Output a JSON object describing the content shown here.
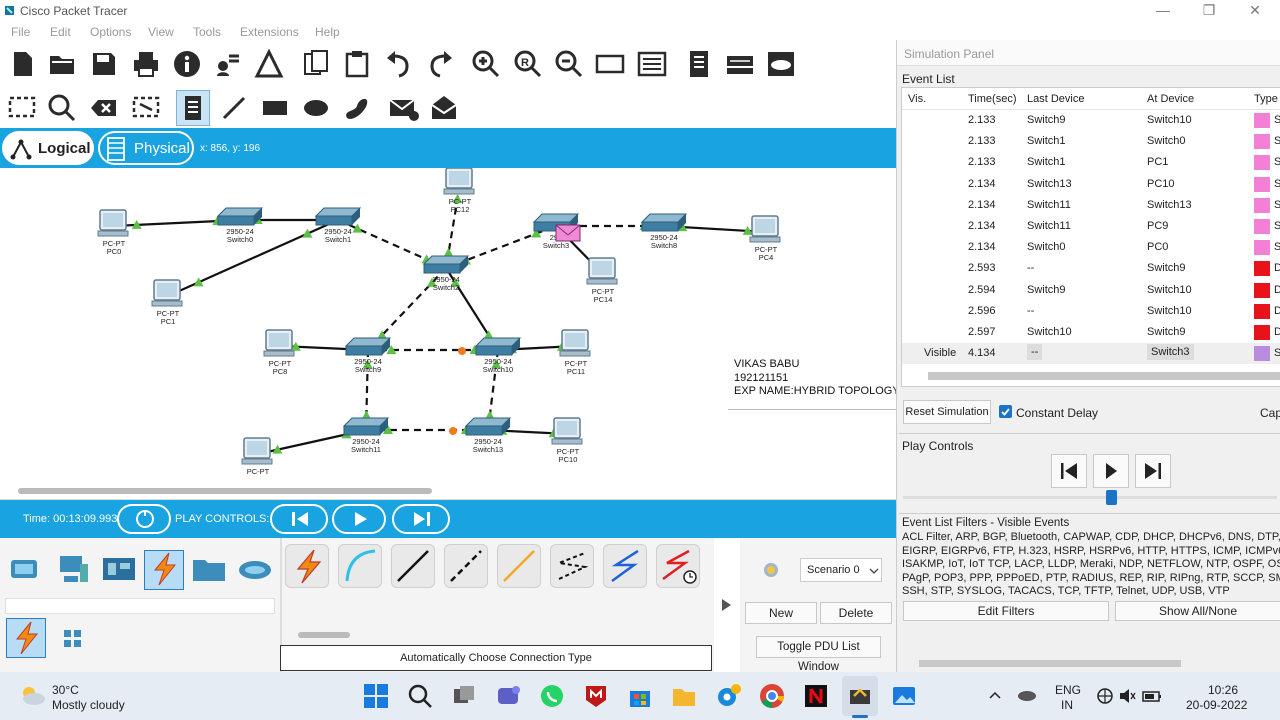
{
  "app": {
    "title": "Cisco Packet Tracer"
  },
  "window_controls": {
    "minimize": "—",
    "maximize": "❐",
    "close": "✕"
  },
  "menu": [
    "File",
    "Edit",
    "Options",
    "View",
    "Tools",
    "Extensions",
    "Help"
  ],
  "mode": {
    "logical": "Logical",
    "physical": "Physical",
    "coords": "x: 856, y: 196"
  },
  "devices": [
    {
      "model": "PC-PT",
      "name": "PC0"
    },
    {
      "model": "PC-PT",
      "name": "PC1"
    },
    {
      "model": "PC-PT",
      "name": "PC12"
    },
    {
      "model": "PC-PT",
      "name": "PC14"
    },
    {
      "model": "PC-PT",
      "name": "PC4"
    },
    {
      "model": "PC-PT",
      "name": "PC8"
    },
    {
      "model": "PC-PT",
      "name": "PC11"
    },
    {
      "model": "PC-PT",
      "name": "PC10"
    },
    {
      "model": "PC-PT",
      "name": ""
    },
    {
      "model": "2950-24",
      "name": "Switch0"
    },
    {
      "model": "2950-24",
      "name": "Switch1"
    },
    {
      "model": "2950-24",
      "name": "Switch2"
    },
    {
      "model": "295",
      "name": "Switch3"
    },
    {
      "model": "2950-24",
      "name": "Switch8"
    },
    {
      "model": "2950-24",
      "name": "Switch9"
    },
    {
      "model": "2950-24",
      "name": "Switch10"
    },
    {
      "model": "2950-24",
      "name": "Switch11"
    },
    {
      "model": "2950-24",
      "name": "Switch13"
    }
  ],
  "note": {
    "line1": "VIKAS BABU",
    "line2": "192121151",
    "line3": "EXP NAME:HYBRID TOPOLOGY"
  },
  "timebar": {
    "time": "Time: 00:13:09.993",
    "play_controls": "PLAY CONTROLS:"
  },
  "bottom": {
    "scenario": "Scenario 0",
    "new": "New",
    "delete": "Delete",
    "toggle": "Toggle PDU List Window",
    "auto_conn": "Automatically Choose Connection Type",
    "info": "i"
  },
  "sim": {
    "title": "Simulation Panel",
    "event_list": "Event List",
    "headers": [
      "Vis.",
      "Time(sec)",
      "Last Device",
      "At Device",
      "Type"
    ],
    "events": [
      {
        "vis": "",
        "time": "2.133",
        "last": "Switch9",
        "at": "Switch10",
        "color": "#f47fd6",
        "type": "S"
      },
      {
        "vis": "",
        "time": "2.133",
        "last": "Switch1",
        "at": "Switch0",
        "color": "#f47fd6",
        "type": "S"
      },
      {
        "vis": "",
        "time": "2.133",
        "last": "Switch1",
        "at": "PC1",
        "color": "#f47fd6",
        "type": "S"
      },
      {
        "vis": "",
        "time": "2.134",
        "last": "Switch13",
        "at": "PC10",
        "color": "#f47fd6",
        "type": "S"
      },
      {
        "vis": "",
        "time": "2.134",
        "last": "Switch11",
        "at": "Switch13",
        "color": "#f47fd6",
        "type": "S"
      },
      {
        "vis": "",
        "time": "2.134",
        "last": "Switch11",
        "at": "PC9",
        "color": "#f47fd6",
        "type": "S"
      },
      {
        "vis": "",
        "time": "2.134",
        "last": "Switch0",
        "at": "PC0",
        "color": "#f47fd6",
        "type": "S"
      },
      {
        "vis": "",
        "time": "2.593",
        "last": "--",
        "at": "Switch9",
        "color": "#e8121b",
        "type": "D"
      },
      {
        "vis": "",
        "time": "2.594",
        "last": "Switch9",
        "at": "Switch10",
        "color": "#e8121b",
        "type": "D"
      },
      {
        "vis": "",
        "time": "2.596",
        "last": "--",
        "at": "Switch10",
        "color": "#e8121b",
        "type": "D"
      },
      {
        "vis": "",
        "time": "2.597",
        "last": "Switch10",
        "at": "Switch9",
        "color": "#e8121b",
        "type": "D"
      },
      {
        "vis": "Visible",
        "time": "4.134",
        "last": "--",
        "at": "Switch3",
        "color": "#b98ce0",
        "type": "S"
      }
    ],
    "reset": "Reset Simulation",
    "constant_delay": "Constant Delay",
    "capture": "Capt",
    "play_controls": "Play Controls",
    "filters_title": "Event List Filters - Visible Events",
    "filters_text": [
      "ACL Filter, ARP, BGP, Bluetooth, CAPWAP, CDP, DHCP, DHCPv6, DNS, DTP, EA",
      "EIGRP, EIGRPv6, FTP, H.323, HSRP, HSRPv6, HTTP, HTTPS, ICMP, ICMPv6, I",
      "ISAKMP, IoT, IoT TCP, LACP, LLDP, Meraki, NDP, NETFLOW, NTP, OSPF, OSPI",
      "PAgP, POP3, PPP, PPPoED, PTP, RADIUS, REP, RIP, RIPng, RTP, SCCP, SMT",
      "SSH, STP, SYSLOG, TACACS, TCP, TFTP, Telnet, UDP, USB, VTP"
    ],
    "edit_filters": "Edit Filters",
    "show_all": "Show All/None"
  },
  "taskbar": {
    "temp": "30°C",
    "weather": "Mostly cloudy",
    "lang1": "ENG",
    "lang2": "IN",
    "time": "10:26",
    "date": "20-09-2022"
  }
}
